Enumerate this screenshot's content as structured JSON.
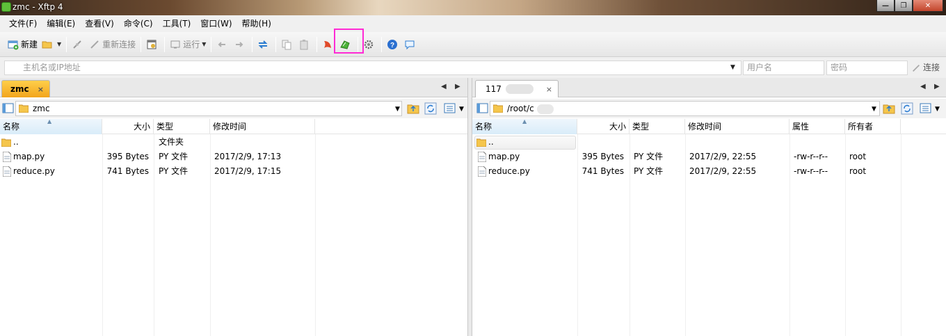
{
  "window": {
    "title": "zmc - Xftp 4"
  },
  "menu": [
    "文件(F)",
    "编辑(E)",
    "查看(V)",
    "命令(C)",
    "工具(T)",
    "窗口(W)",
    "帮助(H)"
  ],
  "toolbar": {
    "new_label": "新建",
    "reconnect_label": "重新连接",
    "run_label": "运行"
  },
  "address": {
    "host_placeholder": "主机名或IP地址",
    "user_placeholder": "用户名",
    "pass_placeholder": "密码",
    "connect_label": "连接"
  },
  "left": {
    "tab": "zmc",
    "path": "zmc",
    "columns": [
      "名称",
      "大小",
      "类型",
      "修改时间"
    ],
    "rows": [
      {
        "name": "..",
        "size": "",
        "type": "文件夹",
        "modified": ""
      },
      {
        "name": "map.py",
        "size": "395 Bytes",
        "type": "PY 文件",
        "modified": "2017/2/9, 17:13"
      },
      {
        "name": "reduce.py",
        "size": "741 Bytes",
        "type": "PY 文件",
        "modified": "2017/2/9, 17:15"
      }
    ]
  },
  "right": {
    "tab": "117",
    "path": "/root/c",
    "columns": [
      "名称",
      "大小",
      "类型",
      "修改时间",
      "属性",
      "所有者"
    ],
    "rows": [
      {
        "name": "..",
        "size": "",
        "type": "",
        "modified": "",
        "attrs": "",
        "owner": ""
      },
      {
        "name": "map.py",
        "size": "395 Bytes",
        "type": "PY 文件",
        "modified": "2017/2/9, 22:55",
        "attrs": "-rw-r--r--",
        "owner": "root"
      },
      {
        "name": "reduce.py",
        "size": "741 Bytes",
        "type": "PY 文件",
        "modified": "2017/2/9, 22:55",
        "attrs": "-rw-r--r--",
        "owner": "root"
      }
    ]
  },
  "colors": {
    "active_tab": "#f2a51c",
    "highlight_box": "#ff2ad4",
    "selected_header": "#d9ecf9"
  }
}
